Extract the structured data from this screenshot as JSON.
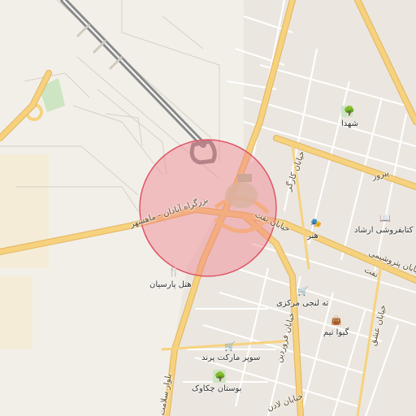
{
  "map": {
    "colors": {
      "background": "#f2efe9",
      "major_road": "#f7d27e",
      "major_road_casing": "#e2b45c",
      "minor_road": "#ffffff",
      "minor_road_casing": "#dcd6cc",
      "runway": "#8a8a8a",
      "park": "#cde5c2",
      "highlight_circle_fill": "#f07a86",
      "highlight_circle_stroke": "#e05566",
      "water": "#a8c8e8"
    },
    "road_labels": {
      "highway_main": "بزرگراه آبادان - ماهشهر",
      "naft_street": "خیابان نفت",
      "naft_street_2": "نفت",
      "kargar_street": "خیابان کارگر",
      "pirooz": "پیروز",
      "pirooshimi": "خیابان پتروشیمی",
      "eshgh": "خیابان عشق",
      "farvardin": "خیابان فروردین",
      "salamat": "بلوار سلامت",
      "ladan": "خیابان لادن"
    },
    "pois": [
      {
        "name": "هتل پارسیان",
        "icon": "restaurant-icon"
      },
      {
        "name": "ته لنجی مرکزی",
        "icon": "shop-icon"
      },
      {
        "name": "هنر",
        "icon": "theater-icon"
      },
      {
        "name": "کتابفروشی ارشاد",
        "icon": "book-icon"
      },
      {
        "name": "گیوا تیم",
        "icon": "bag-icon"
      },
      {
        "name": "سوپر مارکت پرند",
        "icon": "shop-icon"
      },
      {
        "name": "بوستان چکاوک",
        "icon": "park-icon"
      },
      {
        "name": "شهدا",
        "icon": "park-icon"
      }
    ]
  }
}
